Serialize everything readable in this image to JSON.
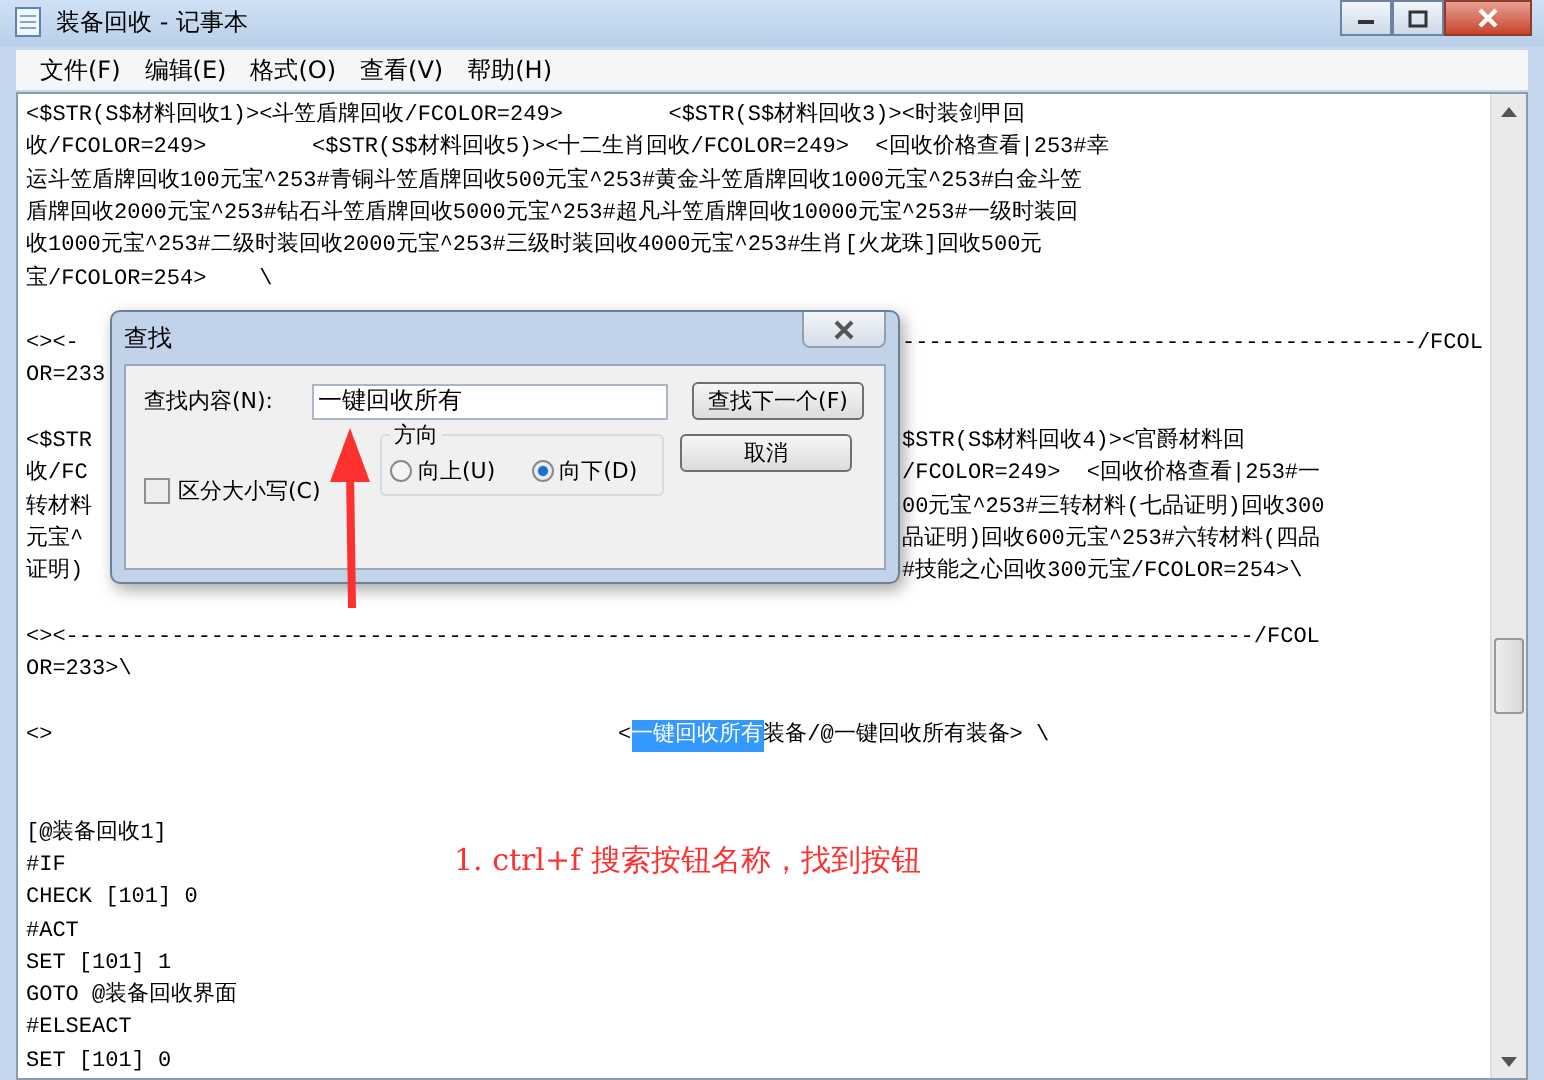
{
  "window": {
    "title": "装备回收 - 记事本"
  },
  "menu": [
    "文件(F)",
    "编辑(E)",
    "格式(O)",
    "查看(V)",
    "帮助(H)"
  ],
  "editor": {
    "lines": [
      {
        "kind": "plain",
        "text": "<$STR(S$材料回收1)><斗笠盾牌回收/FCOLOR=249>        <$STR(S$材料回收3)><时装剑甲回"
      },
      {
        "kind": "plain",
        "text": "收/FCOLOR=249>        <$STR(S$材料回收5)><十二生肖回收/FCOLOR=249>  <回收价格查看|253#幸"
      },
      {
        "kind": "plain",
        "text": "运斗笠盾牌回收100元宝^253#青铜斗笠盾牌回收500元宝^253#黄金斗笠盾牌回收1000元宝^253#白金斗笠"
      },
      {
        "kind": "plain",
        "text": "盾牌回收2000元宝^253#钻石斗笠盾牌回收5000元宝^253#超凡斗笠盾牌回收10000元宝^253#一级时装回"
      },
      {
        "kind": "plain",
        "text": "收1000元宝^253#二级时装回收2000元宝^253#三级时装回收4000元宝^253#生肖[火龙珠]回收500元"
      },
      {
        "kind": "plain",
        "text": "宝/FCOLOR=254>    \\"
      },
      {
        "kind": "blank"
      },
      {
        "kind": "split",
        "left": "<><-",
        "right": "---------------------------------------/FCOL"
      },
      {
        "kind": "split",
        "left": "OR=233"
      },
      {
        "kind": "blank"
      },
      {
        "kind": "split",
        "left": "<$STR",
        "right": "$STR(S$材料回收4)><官爵材料回"
      },
      {
        "kind": "split",
        "left": "收/FC",
        "right": "/FCOLOR=249>  <回收价格查看|253#一"
      },
      {
        "kind": "split",
        "left": "转材料",
        "right": "00元宝^253#三转材料(七品证明)回收300"
      },
      {
        "kind": "split",
        "left": "元宝^",
        "right": "品证明)回收600元宝^253#六转材料(四品"
      },
      {
        "kind": "split",
        "left": "证明)",
        "right": "#技能之心回收300元宝/FCOLOR=254>\\"
      },
      {
        "kind": "blank"
      },
      {
        "kind": "plain",
        "text": "<><------------------------------------------------------------------------------------------/FCOL"
      },
      {
        "kind": "plain",
        "text": "OR=233>\\"
      },
      {
        "kind": "blank"
      },
      {
        "kind": "match",
        "left": "<>",
        "before": "<",
        "match": "一键回收所有",
        "after": "装备/@一键回收所有装备> \\"
      },
      {
        "kind": "blank"
      },
      {
        "kind": "blank"
      },
      {
        "kind": "plain",
        "text": "[@装备回收1]"
      },
      {
        "kind": "plain",
        "text": "#IF"
      },
      {
        "kind": "plain",
        "text": "CHECK [101] 0"
      },
      {
        "kind": "plain",
        "text": "#ACT"
      },
      {
        "kind": "plain",
        "text": "SET [101] 1"
      },
      {
        "kind": "plain",
        "text": "GOTO @装备回收界面"
      },
      {
        "kind": "plain",
        "text": "#ELSEACT"
      },
      {
        "kind": "plain",
        "text": "SET [101] 0"
      }
    ]
  },
  "find_dialog": {
    "title": "查找",
    "label": "查找内容(N):",
    "value": "一键回收所有",
    "find_next_button": "查找下一个(F)",
    "cancel_button": "取消",
    "match_case": {
      "label": "区分大小写(C)",
      "checked": false
    },
    "direction": {
      "legend": "方向",
      "options": [
        {
          "label": "向上(U)",
          "selected": false
        },
        {
          "label": "向下(D)",
          "selected": true
        }
      ]
    }
  },
  "annotation": {
    "text": "1. ctrl+f 搜索按钮名称，找到按钮"
  }
}
